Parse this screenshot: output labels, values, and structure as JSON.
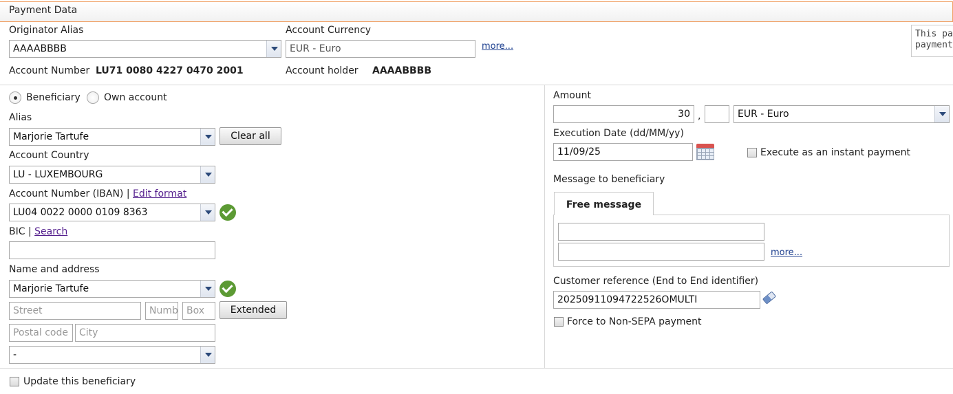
{
  "header": {
    "title": "Payment Data"
  },
  "originator": {
    "alias_label": "Originator Alias",
    "alias_value": "AAAABBBB",
    "currency_label": "Account Currency",
    "currency_value": "EUR - Euro",
    "more_label": "more...",
    "account_number_label": "Account Number",
    "account_number_value": "LU71 0080 4227 0470 2001",
    "account_holder_label": "Account holder",
    "account_holder_value": "AAAABBBB"
  },
  "info_box": {
    "line1": "This pay",
    "line2": "payment"
  },
  "beneficiary": {
    "radio_beneficiary": "Beneficiary",
    "radio_own": "Own account",
    "alias_label": "Alias",
    "alias_value": "Marjorie Tartufe",
    "clear_all": "Clear all",
    "country_label": "Account Country",
    "country_value": "LU - LUXEMBOURG",
    "iban_label": "Account Number (IBAN) |",
    "edit_format": "Edit format",
    "iban_value": "LU04 0022 0000 0109 8363",
    "bic_label": "BIC |",
    "bic_search": "Search",
    "bic_value": "",
    "name_label": "Name and address",
    "name_value": "Marjorie Tartufe",
    "street_placeholder": "Street",
    "number_placeholder": "Number",
    "box_placeholder": "Box",
    "extended": "Extended",
    "postal_placeholder": "Postal code",
    "city_placeholder": "City",
    "country2_value": "-",
    "update_label": "Update this beneficiary"
  },
  "payment": {
    "amount_label": "Amount",
    "amount_value": "30",
    "amount_sep": ",",
    "amount_cents": "",
    "currency_value": "EUR - Euro",
    "exec_date_label": "Execution Date (dd/MM/yy)",
    "exec_date_value": "11/09/25",
    "instant_label": "Execute as an instant payment",
    "message_label": "Message to beneficiary",
    "tab_free": "Free message",
    "message_line1": "",
    "message_line2": "",
    "more_label": "more...",
    "customer_ref_label": "Customer reference (End to End identifier)",
    "customer_ref_value": "20250911094722526OMULTI",
    "force_label": "Force to Non-SEPA payment"
  }
}
